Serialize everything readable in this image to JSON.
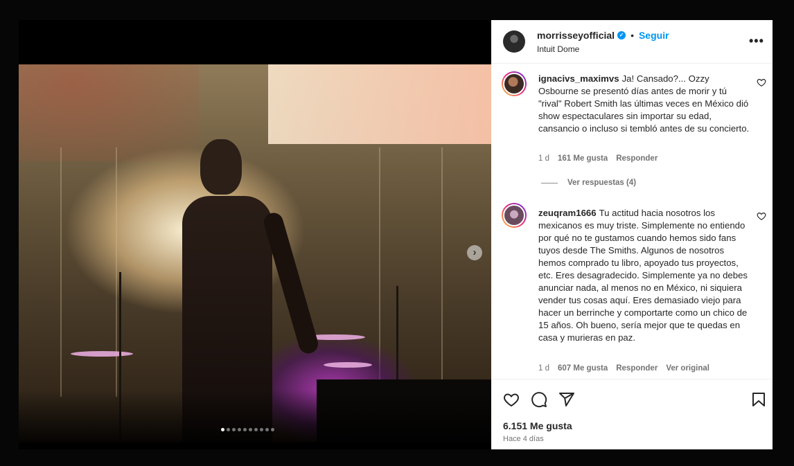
{
  "post": {
    "username": "morrisseyofficial",
    "follow_label": "Seguir",
    "separator": "•",
    "location": "Intuit Dome",
    "more_label": "•••"
  },
  "carousel": {
    "next_label": "›",
    "total_images": 10,
    "current_index": 1
  },
  "comments": [
    {
      "username": "ignacivs_maximvs",
      "text": "Ja! Cansado?... Ozzy Osbourne se presentó días antes de morir y tú \"rival\" Robert Smith las últimas veces en México dió show espectaculares sin importar su edad, cansancio o incluso si tembló antes de su concierto.",
      "age": "1 d",
      "likes": "161 Me gusta",
      "reply_label": "Responder",
      "view_replies": "Ver respuestas (4)"
    },
    {
      "username": "zeuqram1666",
      "text": "Tu actitud hacia nosotros los mexicanos es muy triste. Simplemente no entiendo por qué no te gustamos cuando hemos sido fans tuyos desde The Smiths. Algunos de nosotros hemos comprado tu libro, apoyado tus proyectos, etc. Eres desagradecido. Simplemente ya no debes anunciar nada, al menos no en México, ni siquiera vender tus cosas aquí. Eres demasiado viejo para hacer un berrinche y comportarte como un chico de 15 años. Oh bueno, sería mejor que te quedas en casa y murieras en paz.",
      "age": "1 d",
      "likes": "607 Me gusta",
      "reply_label": "Responder",
      "original_label": "Ver original"
    }
  ],
  "footer": {
    "likes": "6.151 Me gusta",
    "posted": "Hace 4 días"
  },
  "icons": {
    "verified": "verified-badge-icon",
    "like": "heart-icon",
    "comment": "comment-icon",
    "share": "share-icon",
    "save": "bookmark-icon"
  },
  "colors": {
    "accent": "#0095f6",
    "muted": "#737373",
    "text": "#262626"
  }
}
